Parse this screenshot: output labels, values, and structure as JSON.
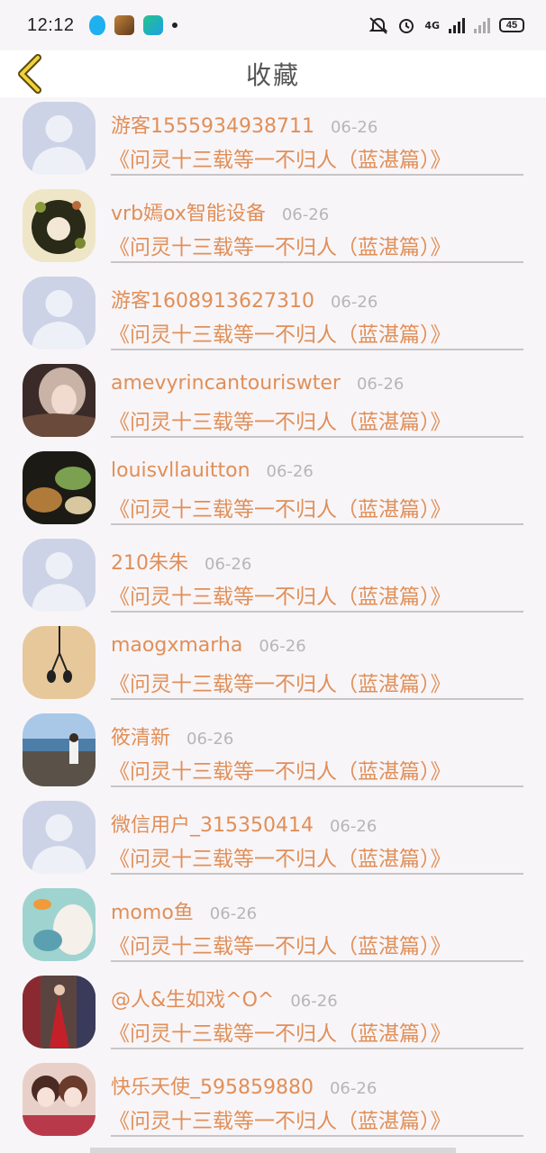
{
  "status_bar": {
    "time": "12:12",
    "apps": [
      "qq-icon",
      "game-icon",
      "video-app-icon"
    ],
    "network": "4G",
    "battery": "45"
  },
  "header": {
    "title": "收藏",
    "back_icon": "back-chevron-icon"
  },
  "colors": {
    "accent": "#e08f58",
    "date": "#b6b6b6",
    "background": "#f8f5f8",
    "divider": "#c8c5c6"
  },
  "items": [
    {
      "username": "游客1555934938711",
      "date": "06-26",
      "title": "《问灵十三载等一不归人（蓝湛篇）》",
      "avatar": "default-avatar"
    },
    {
      "username": "vrb嫣ox智能设备",
      "date": "06-26",
      "title": "《问灵十三载等一不归人（蓝湛篇）》",
      "avatar": "floral-avatar"
    },
    {
      "username": "游客1608913627310",
      "date": "06-26",
      "title": "《问灵十三载等一不归人（蓝湛篇）》",
      "avatar": "default-avatar"
    },
    {
      "username": "amevyrincantouriswter",
      "date": "06-26",
      "title": "《问灵十三载等一不归人（蓝湛篇）》",
      "avatar": "girl-photo-avatar"
    },
    {
      "username": "louisvllauitton",
      "date": "06-26",
      "title": "《问灵十三载等一不归人（蓝湛篇）》",
      "avatar": "food-photo-avatar"
    },
    {
      "username": "210朱朱",
      "date": "06-26",
      "title": "《问灵十三载等一不归人（蓝湛篇）》",
      "avatar": "default-avatar"
    },
    {
      "username": "maogxmarha",
      "date": "06-26",
      "title": "《问灵十三载等一不归人（蓝湛篇）》",
      "avatar": "earphone-avatar"
    },
    {
      "username": "筱清新",
      "date": "06-26",
      "title": "《问灵十三载等一不归人（蓝湛篇）》",
      "avatar": "beach-photo-avatar"
    },
    {
      "username": "微信用户_315350414",
      "date": "06-26",
      "title": "《问灵十三载等一不归人（蓝湛篇）》",
      "avatar": "default-avatar"
    },
    {
      "username": "momo鱼",
      "date": "06-26",
      "title": "《问灵十三载等一不归人（蓝湛篇）》",
      "avatar": "anime-fish-avatar"
    },
    {
      "username": "@人&生如戏^O^",
      "date": "06-26",
      "title": "《问灵十三载等一不归人（蓝湛篇）》",
      "avatar": "red-dress-photo-avatar"
    },
    {
      "username": "快乐天使_595859880",
      "date": "06-26",
      "title": "《问灵十三载等一不归人（蓝湛篇）》",
      "avatar": "anime-couple-avatar"
    }
  ]
}
